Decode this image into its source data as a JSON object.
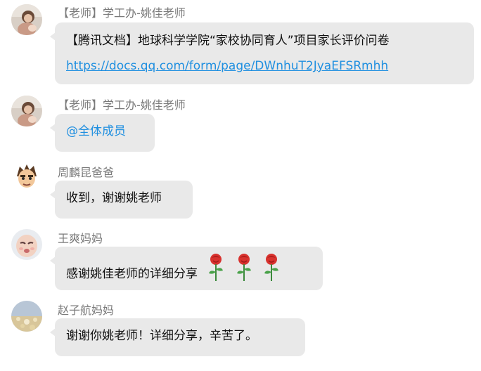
{
  "messages": [
    {
      "sender": "【老师】学工办-姚佳老师",
      "line1": "【腾讯文档】地球科学学院“家校协同育人”项目家长评价问卷",
      "link": "https://docs.qq.com/form/page/DWnhuT2JyaEFSRmhh"
    },
    {
      "sender": "【老师】学工办-姚佳老师",
      "text": "@全体成员"
    },
    {
      "sender": "周麟昆爸爸",
      "text": "收到，谢谢姚老师"
    },
    {
      "sender": "王爽妈妈",
      "text": "感谢姚佳老师的详细分享",
      "emoji": [
        "rose-icon",
        "rose-icon",
        "rose-icon"
      ]
    },
    {
      "sender": "赵子航妈妈",
      "text": "谢谢你姚老师！详细分享，辛苦了。"
    }
  ],
  "colors": {
    "bubble": "#e9e9e9",
    "link": "#1f8fe0",
    "sender": "#7a7a7a"
  }
}
